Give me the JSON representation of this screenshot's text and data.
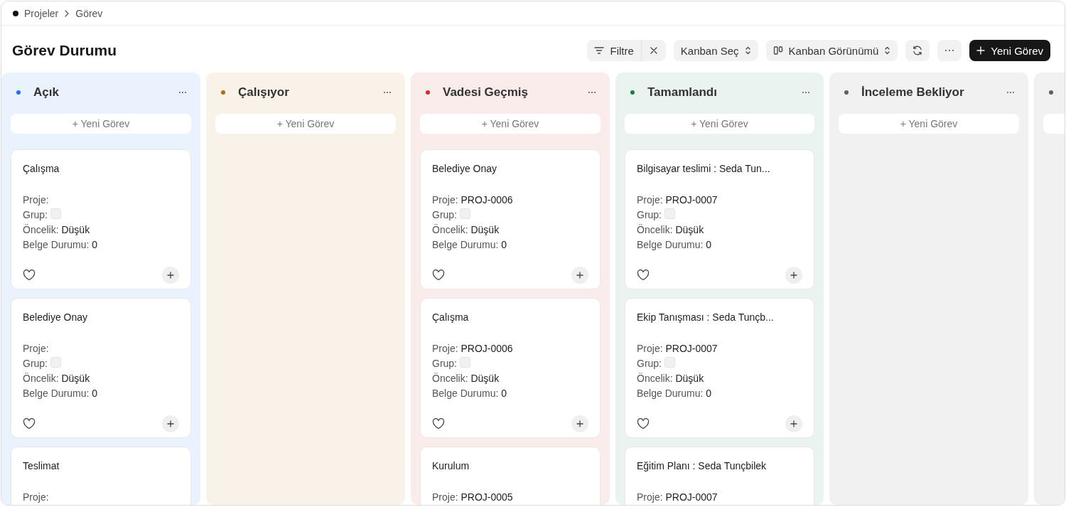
{
  "breadcrumb": [
    "Projeler",
    "Görev"
  ],
  "title": "Görev Durumu",
  "toolbar": {
    "filter": "Filtre",
    "kanban_select": "Kanban Seç",
    "kanban_view": "Kanban Görünümü",
    "new_task": "Yeni Görev"
  },
  "columns": [
    {
      "title": "Açık",
      "color": "#1a73e8",
      "add_label": "+ Yeni Görev",
      "cards": [
        {
          "title": "Çalışma",
          "fields": [
            {
              "kind": "text",
              "label": "Proje:"
            },
            {
              "kind": "swatch",
              "label": "Grup:"
            },
            {
              "kind": "text",
              "label": "Öncelik:",
              "value": "Düşük"
            },
            {
              "kind": "text",
              "label": "Belge Durumu:",
              "value": "0"
            }
          ]
        },
        {
          "title": "Belediye Onay",
          "fields": [
            {
              "kind": "text",
              "label": "Proje:"
            },
            {
              "kind": "swatch",
              "label": "Grup:"
            },
            {
              "kind": "text",
              "label": "Öncelik:",
              "value": "Düşük"
            },
            {
              "kind": "text",
              "label": "Belge Durumu:",
              "value": "0"
            }
          ]
        },
        {
          "title": "Teslimat",
          "fields": [
            {
              "kind": "text",
              "label": "Proje:"
            }
          ]
        }
      ]
    },
    {
      "title": "Çalışıyor",
      "color": "#b86a0c",
      "add_label": "+ Yeni Görev"
    },
    {
      "title": "Vadesi Geçmiş",
      "color": "#d12c2c",
      "add_label": "+ Yeni Görev",
      "cards": [
        {
          "title": "Belediye Onay",
          "fields": [
            {
              "kind": "text",
              "label": "Proje:",
              "value": "PROJ-0006"
            },
            {
              "kind": "swatch",
              "label": "Grup:"
            },
            {
              "kind": "text",
              "label": "Öncelik:",
              "value": "Düşük"
            },
            {
              "kind": "text",
              "label": "Belge Durumu:",
              "value": "0"
            }
          ]
        },
        {
          "title": "Çalışma",
          "fields": [
            {
              "kind": "text",
              "label": "Proje:",
              "value": "PROJ-0006"
            },
            {
              "kind": "swatch",
              "label": "Grup:"
            },
            {
              "kind": "text",
              "label": "Öncelik:",
              "value": "Düşük"
            },
            {
              "kind": "text",
              "label": "Belge Durumu:",
              "value": "0"
            }
          ]
        },
        {
          "title": "Kurulum",
          "fields": [
            {
              "kind": "text",
              "label": "Proje:",
              "value": "PROJ-0005"
            }
          ]
        }
      ]
    },
    {
      "title": "Tamamlandı",
      "color": "#1a7f4b",
      "add_label": "+ Yeni Görev",
      "cards": [
        {
          "title": "Bilgisayar teslimi : Seda Tun...",
          "fields": [
            {
              "kind": "text",
              "label": "Proje:",
              "value": "PROJ-0007"
            },
            {
              "kind": "swatch",
              "label": "Grup:"
            },
            {
              "kind": "text",
              "label": "Öncelik:",
              "value": "Düşük"
            },
            {
              "kind": "text",
              "label": "Belge Durumu:",
              "value": "0"
            }
          ]
        },
        {
          "title": "Ekip Tanışması : Seda Tunçb...",
          "fields": [
            {
              "kind": "text",
              "label": "Proje:",
              "value": "PROJ-0007"
            },
            {
              "kind": "swatch",
              "label": "Grup:"
            },
            {
              "kind": "text",
              "label": "Öncelik:",
              "value": "Düşük"
            },
            {
              "kind": "text",
              "label": "Belge Durumu:",
              "value": "0"
            }
          ]
        },
        {
          "title": "Eğitim Planı : Seda Tunçbilek",
          "fields": [
            {
              "kind": "text",
              "label": "Proje:",
              "value": "PROJ-0007"
            }
          ]
        }
      ]
    },
    {
      "title": "İnceleme Bekliyor",
      "color": "#5f5f5f",
      "add_label": "+ Yeni Görev"
    },
    {
      "color": "#5f5f5f"
    }
  ]
}
